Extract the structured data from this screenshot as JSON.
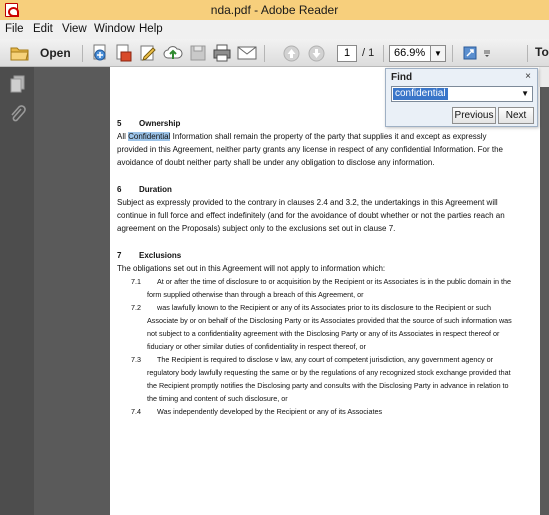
{
  "window": {
    "title": "nda.pdf - Adobe Reader"
  },
  "menu": {
    "items": [
      "File",
      "Edit",
      "View",
      "Window",
      "Help"
    ]
  },
  "toolbar": {
    "open_label": "Open",
    "page_current": "1",
    "page_total": "/ 1",
    "zoom": "66.9%",
    "tools_label": "To"
  },
  "find": {
    "title": "Find",
    "close": "×",
    "query": "confidential",
    "previous_label": "Previous",
    "next_label": "Next"
  },
  "doc": {
    "s5": {
      "num": "5",
      "title": "Ownership",
      "pre": "All ",
      "highlight": "Confidential",
      "post": " Information shall remain the property of the party that supplies it and except as expressly provided in this Agreement, neither party grants any license in respect of any confidential Information. For the avoidance of doubt neither party shall be under any obligation to disclose any information."
    },
    "s6": {
      "num": "6",
      "title": "Duration",
      "text": "Subject as expressly provided to the contrary in clauses 2.4 and 3.2, the undertakings in this Agreement will continue in full force and effect indefinitely (and for the avoidance of doubt whether or not the parties reach an agreement on the Proposals) subject only to the exclusions set out in clause 7."
    },
    "s7": {
      "num": "7",
      "title": "Exclusions",
      "intro": "The obligations set out in this Agreement will not apply to information which:",
      "items": [
        {
          "num": "7.1",
          "text": "At or after the time of disclosure to or acquisition by the Recipient or its Associates is in the public domain in the form supplied otherwise than through a breach of this Agreement, or"
        },
        {
          "num": "7.2",
          "text": "was lawfully known to the Recipient or any of its Associates prior to its disclosure to the Recipient or such Associate by or on behalf of the Disclosing Party or its Associates provided that the source of such information was not subject to a confidentiality agreement with the Disclosing Party or any of its Associates in respect thereof or fiduciary or other similar duties of confidentiality in respect thereof, or"
        },
        {
          "num": "7.3",
          "text": "The Recipient is required to disclose v law, any court of competent jurisdiction, any government agency or regulatory body lawfully requesting the same or by the regulations of any recognized stock exchange provided that the Recipient promptly notifies the Disclosing party and consults with the Disclosing Party in advance in relation to the timing and content of such disclosure, or"
        },
        {
          "num": "7.4",
          "text": "Was independently developed by the Recipient or any of its Associates"
        }
      ]
    }
  },
  "icons": [
    "pdf-app-icon",
    "folder-icon",
    "create-pdf-icon",
    "combine-icon",
    "sign-icon",
    "cloud-upload-icon",
    "save-icon",
    "print-icon",
    "email-icon",
    "page-up-icon",
    "page-down-icon",
    "fit-page-icon",
    "sidebar-pages-icon",
    "sidebar-attachments-icon"
  ],
  "colors": {
    "titlebar": "#f7cf7c",
    "highlight": "#9cc3e8",
    "selection": "#3a76c9",
    "viewer_bg": "#5a5a5a"
  }
}
